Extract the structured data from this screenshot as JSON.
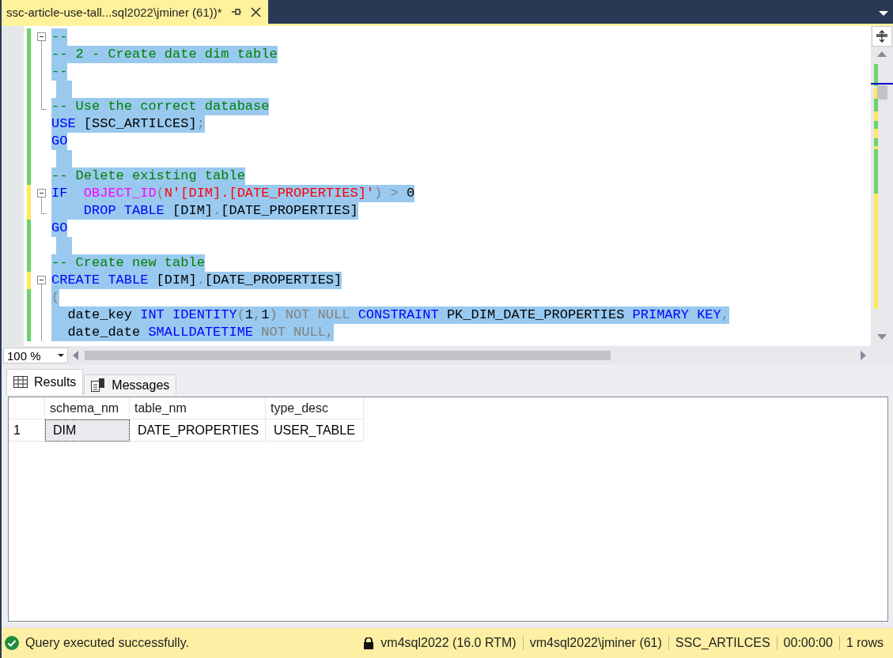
{
  "document_tab": {
    "title": "ssc-article-use-tall...sql2022\\jminer (61))*"
  },
  "editor": {
    "lines": [
      {
        "unsaved": false,
        "kind": "opener",
        "selected": true,
        "tokens": [
          {
            "kind": "comment",
            "text": "--"
          }
        ]
      },
      {
        "unsaved": false,
        "kind": "body",
        "selected": true,
        "tokens": [
          {
            "kind": "comment",
            "text": "-- 2 - Create date dim table"
          }
        ]
      },
      {
        "unsaved": false,
        "kind": "body",
        "selected": true,
        "tokens": [
          {
            "kind": "comment",
            "text": "--"
          }
        ]
      },
      {
        "unsaved": false,
        "kind": "body",
        "selected": true
      },
      {
        "unsaved": false,
        "kind": "closer",
        "selected": true,
        "tokens": [
          {
            "kind": "comment",
            "text": "-- Use the correct database"
          }
        ]
      },
      {
        "unsaved": false,
        "kind": "plain",
        "selected": true,
        "tokens": [
          {
            "kind": "keyword",
            "text": "USE"
          },
          {
            "kind": "plain",
            "text": " [SSC_ARTILCES]"
          },
          {
            "kind": "operator",
            "text": ";"
          }
        ]
      },
      {
        "unsaved": false,
        "kind": "plain",
        "selected": true,
        "tokens": [
          {
            "kind": "keyword",
            "text": "GO"
          }
        ]
      },
      {
        "unsaved": false,
        "kind": "plain",
        "selected": true
      },
      {
        "unsaved": false,
        "kind": "plain",
        "selected": true,
        "tokens": [
          {
            "kind": "comment",
            "text": "-- Delete existing table"
          }
        ]
      },
      {
        "unsaved": true,
        "kind": "opener",
        "selected": true,
        "tokens": [
          {
            "kind": "keyword",
            "text": "IF"
          },
          {
            "kind": "function",
            "text": "  OBJECT_ID"
          },
          {
            "kind": "operator",
            "text": "("
          },
          {
            "kind": "string",
            "text": "N'[DIM].[DATE_PROPERTIES]'"
          },
          {
            "kind": "operator",
            "text": ") > "
          },
          {
            "kind": "plain",
            "text": "0"
          }
        ]
      },
      {
        "unsaved": true,
        "kind": "closer",
        "selected": true,
        "tokens": [
          {
            "kind": "keyword",
            "text": "    DROP TABLE"
          },
          {
            "kind": "plain",
            "text": " [DIM]"
          },
          {
            "kind": "operator",
            "text": "."
          },
          {
            "kind": "plain",
            "text": "[DATE_PROPERTIES]"
          }
        ]
      },
      {
        "unsaved": false,
        "kind": "plain",
        "selected": true,
        "tokens": [
          {
            "kind": "keyword",
            "text": "GO"
          }
        ]
      },
      {
        "unsaved": false,
        "kind": "plain",
        "selected": true
      },
      {
        "unsaved": false,
        "kind": "plain",
        "selected": true,
        "tokens": [
          {
            "kind": "comment",
            "text": "-- Create new table"
          }
        ]
      },
      {
        "unsaved": true,
        "kind": "opener",
        "selected": true,
        "tokens": [
          {
            "kind": "keyword",
            "text": "CREATE TABLE"
          },
          {
            "kind": "plain",
            "text": " [DIM]"
          },
          {
            "kind": "operator",
            "text": "."
          },
          {
            "kind": "plain",
            "text": "[DATE_PROPERTIES]"
          }
        ]
      },
      {
        "unsaved": false,
        "kind": "body",
        "selected": true,
        "tokens": [
          {
            "kind": "operator",
            "text": "("
          }
        ]
      },
      {
        "unsaved": false,
        "kind": "body",
        "selected": true,
        "tokens": [
          {
            "kind": "plain",
            "text": "  date_key "
          },
          {
            "kind": "keyword",
            "text": "INT IDENTITY"
          },
          {
            "kind": "operator",
            "text": "("
          },
          {
            "kind": "plain",
            "text": "1"
          },
          {
            "kind": "operator",
            "text": ","
          },
          {
            "kind": "plain",
            "text": "1"
          },
          {
            "kind": "operator",
            "text": ") NOT NULL "
          },
          {
            "kind": "keyword",
            "text": "CONSTRAINT"
          },
          {
            "kind": "plain",
            "text": " PK_DIM_DATE_PROPERTIES "
          },
          {
            "kind": "keyword",
            "text": "PRIMARY KEY"
          },
          {
            "kind": "operator",
            "text": ","
          }
        ]
      },
      {
        "unsaved": false,
        "kind": "body",
        "selected": true,
        "tokens": [
          {
            "kind": "plain",
            "text": "  date_date "
          },
          {
            "kind": "keyword",
            "text": "SMALLDATETIME"
          },
          {
            "kind": "operator",
            "text": " NOT NULL,"
          }
        ]
      }
    ]
  },
  "zoom": {
    "value": "100 %"
  },
  "results_tabs": [
    {
      "label": "Results",
      "kind": "grid",
      "selected": true
    },
    {
      "label": "Messages",
      "kind": "messages",
      "selected": false
    }
  ],
  "grid": {
    "columns": [
      "schema_nm",
      "table_nm",
      "type_desc"
    ],
    "rows": [
      {
        "number": "1",
        "cells": [
          {
            "text": "DIM",
            "selected": true
          },
          {
            "text": "DATE_PROPERTIES",
            "selected": false
          },
          {
            "text": "USER_TABLE",
            "selected": false
          }
        ]
      }
    ]
  },
  "status_bar": {
    "message": "Query executed successfully.",
    "items": [
      {
        "kind": "locked",
        "text": "vm4sql2022 (16.0 RTM)"
      },
      {
        "kind": "plain",
        "text": "vm4sql2022\\jminer (61)"
      },
      {
        "kind": "plain",
        "text": "SSC_ARTILCES"
      },
      {
        "kind": "plain",
        "text": "00:00:00"
      },
      {
        "kind": "plain",
        "text": "1 rows"
      }
    ]
  }
}
